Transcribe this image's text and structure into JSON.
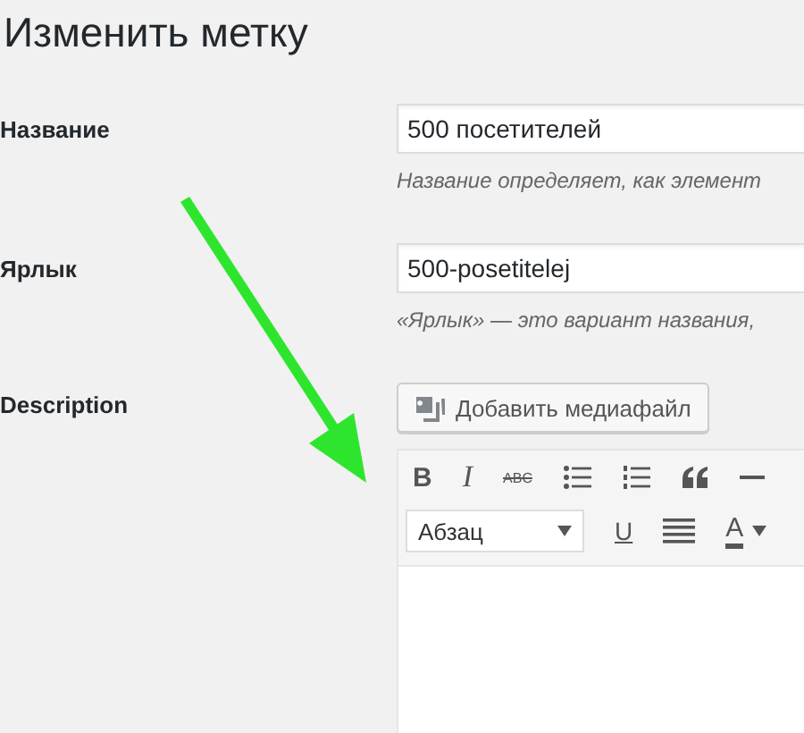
{
  "page_title": "Изменить метку",
  "fields": [
    {
      "label": "Название",
      "value": "500 посетителей",
      "description": "Название определяет, как элемент"
    },
    {
      "label": "Ярлык",
      "value": "500-posetitelej",
      "description": "«Ярлык» — это вариант названия,"
    }
  ],
  "description_field": {
    "label": "Description",
    "media_button": "Добавить медиафайл",
    "toolbar_row_1": [
      {
        "kind": "bold",
        "text": "B"
      },
      {
        "kind": "italic",
        "text": "I"
      },
      {
        "kind": "strike",
        "text": "ABC"
      },
      {
        "kind": "bullet-list"
      },
      {
        "kind": "numbered-list"
      },
      {
        "kind": "quote"
      },
      {
        "kind": "horizontal-line"
      }
    ],
    "toolbar_row_2": [
      {
        "kind": "select",
        "text": "Абзац"
      },
      {
        "kind": "underline",
        "text": "U"
      },
      {
        "kind": "justify"
      },
      {
        "kind": "color",
        "text": "A"
      }
    ]
  }
}
